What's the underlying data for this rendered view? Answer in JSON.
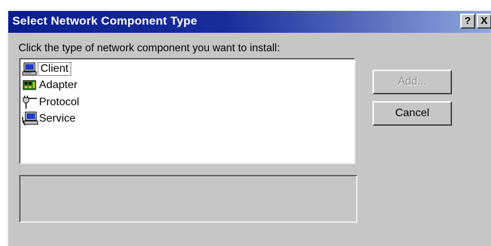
{
  "window": {
    "title": "Select Network Component Type",
    "help_label": "?",
    "close_label": "X"
  },
  "dialog": {
    "prompt": "Click the type of network component you want to install:",
    "components": [
      {
        "label": "Client",
        "icon": "client-computer-icon",
        "selected": true
      },
      {
        "label": "Adapter",
        "icon": "network-adapter-icon",
        "selected": false
      },
      {
        "label": "Protocol",
        "icon": "protocol-plug-icon",
        "selected": false
      },
      {
        "label": "Service",
        "icon": "service-computer-icon",
        "selected": false
      }
    ],
    "description": ""
  },
  "buttons": {
    "add_label": "Add...",
    "add_enabled": false,
    "cancel_label": "Cancel"
  }
}
